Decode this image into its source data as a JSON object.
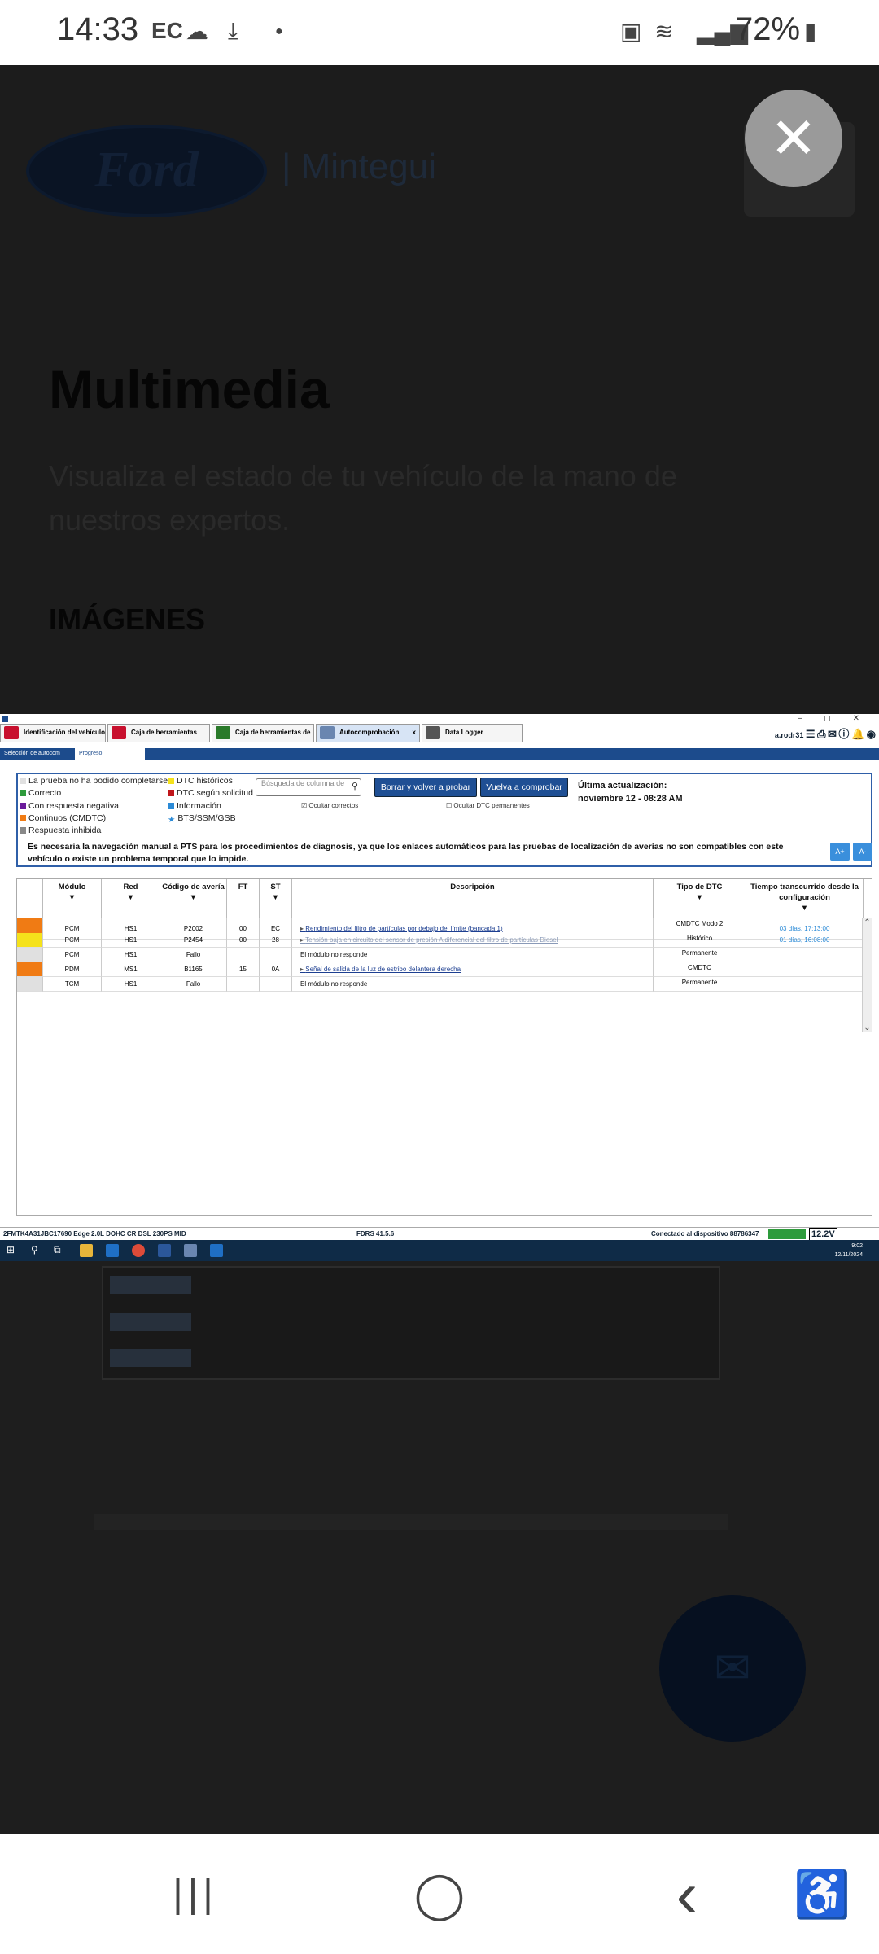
{
  "status_bar": {
    "time": "14:33",
    "carrier": "EC",
    "battery": "72%"
  },
  "background_page": {
    "brand_logo": "Ford",
    "brand": "| Mintegui",
    "title": "Multimedia",
    "subtitle": "Visualiza el estado de tu vehículo de la mano de nuestros expertos.",
    "section": "IMÁGENES"
  },
  "viewer": {
    "close_icon": "✕"
  },
  "fdrs": {
    "tabs": [
      {
        "label": "Identificación del vehículo",
        "color": "#c8102e"
      },
      {
        "label": "Caja de herramientas",
        "color": "#c8102e"
      },
      {
        "label": "Caja de herramientas de m",
        "color": "#2a7a2a"
      },
      {
        "label": "Autocomprobación",
        "color": "#6a86b0"
      },
      {
        "label": "Data Logger",
        "color": "#555555"
      }
    ],
    "active_tab_close": "x",
    "user": "a.rodr31",
    "window_controls": "– ◻ ✕",
    "subtabs": [
      "Selección de autocom",
      "Progreso"
    ],
    "legend": [
      {
        "label": "La prueba no ha podido completarse",
        "color": "#e0e0e0"
      },
      {
        "label": "Correcto",
        "color": "#2e9b3c"
      },
      {
        "label": "Con respuesta negativa",
        "color": "#6a1b9a"
      },
      {
        "label": "Continuos (CMDTC)",
        "color": "#f07b14"
      },
      {
        "label": "Respuesta inhibida",
        "color": "#888888"
      },
      {
        "label": "DTC históricos",
        "color": "#f5e21b"
      },
      {
        "label": "DTC según solicitud",
        "color": "#c0161a"
      },
      {
        "label": "Información",
        "color": "#2b8ad6"
      },
      {
        "label": "BTS/SSM/GSB",
        "color": "#2b8ad6"
      }
    ],
    "search_placeholder": "Búsqueda de columna de",
    "btn_clear_retest": "Borrar y volver a probar",
    "btn_recheck": "Vuelva a comprobar",
    "hide_correct": "☑ Ocultar correctos",
    "hide_permanent": "☐ Ocultar DTC permanentes",
    "last_update_label": "Última actualización:",
    "last_update_value": "noviembre 12 - 08:28 AM",
    "notice": "Es necesaria la navegación manual a PTS para los procedimientos de diagnosis, ya que los enlaces automáticos para las pruebas de localización de averías no son compatibles con este vehículo o existe un problema temporal que lo impide.",
    "font_up": "A+",
    "font_down": "A-",
    "columns": [
      "Módulo",
      "Red",
      "Código de avería",
      "FT",
      "ST",
      "Descripción",
      "Tipo de DTC",
      "Tiempo transcurrido desde la configuración"
    ],
    "sort_glyph": "▼",
    "rows": [
      {
        "status_color": "#f07b14",
        "module": "PCM",
        "net": "HS1",
        "code": "P2002",
        "ft": "00",
        "st": "EC",
        "desc": "Rendimiento del filtro de partículas por debajo del límite (bancada 1)",
        "type": "CMDTC Modo 2",
        "elapsed": "03 días, 17:13:00"
      },
      {
        "status_color": "#f5e21b",
        "module": "PCM",
        "net": "HS1",
        "code": "P2454",
        "ft": "00",
        "st": "28",
        "desc": "Tensión baja en circuito del sensor de presión A diferencial del filtro de partículas Diesel",
        "type": "Histórico",
        "elapsed": "01 días, 16:08:00"
      },
      {
        "status_color": "#e0e0e0",
        "module": "PCM",
        "net": "HS1",
        "code": "Fallo",
        "ft": "",
        "st": "",
        "desc": "El módulo no responde",
        "type": "Permanente",
        "elapsed": ""
      },
      {
        "status_color": "#f07b14",
        "module": "PDM",
        "net": "MS1",
        "code": "B1165",
        "ft": "15",
        "st": "0A",
        "desc": "Señal de salida de la luz de estribo delantera derecha",
        "type": "CMDTC",
        "elapsed": ""
      },
      {
        "status_color": "#e0e0e0",
        "module": "TCM",
        "net": "HS1",
        "code": "Fallo",
        "ft": "",
        "st": "",
        "desc": "El módulo no responde",
        "type": "Permanente",
        "elapsed": ""
      }
    ],
    "scroll_up": "⌃",
    "scroll_down": "⌄",
    "vin": "2FMTK4A31JBC17690   Edge 2.0L DOHC CR DSL 230PS MID",
    "version": "FDRS 41.5.6",
    "connection": "Conectado al dispositivo 88786347",
    "voltage": "12.2V",
    "tray_time": "9:02",
    "tray_date": "12/11/2024"
  },
  "nav": {
    "recents": "|||",
    "home": "◯",
    "back": "‹",
    "accessibility": "♿"
  }
}
